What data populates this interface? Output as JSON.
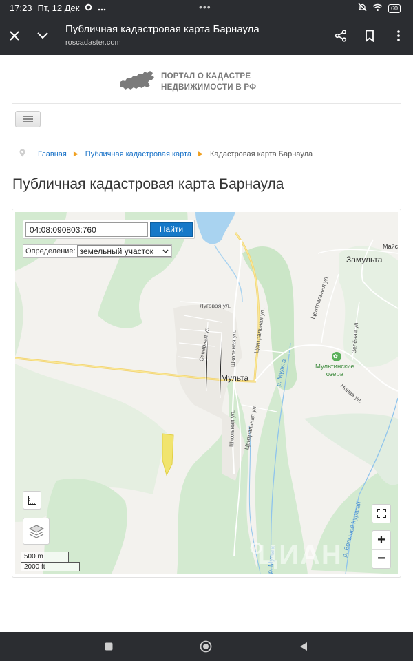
{
  "status_bar": {
    "time": "17:23",
    "date": "Пт, 12 Дек",
    "battery": "60",
    "icons": [
      "notification-dot-icon",
      "more-dots-icon",
      "mute-bell-icon",
      "wifi-icon",
      "battery-icon"
    ]
  },
  "browser": {
    "title": "Публичная кадастровая карта Барнаула",
    "url": "roscadaster.com",
    "icons": [
      "close-icon",
      "chevron-down-icon",
      "share-icon",
      "bookmark-icon",
      "kebab-menu-icon"
    ]
  },
  "site": {
    "logo_line1": "ПОРТАЛ О КАДАСТРЕ",
    "logo_line2": "НЕДВИЖИМОСТИ В РФ"
  },
  "breadcrumb": {
    "home": "Главная",
    "map": "Публичная кадастровая карта",
    "current": "Кадастровая карта Барнаула"
  },
  "page_title": "Публичная кадастровая карта Барнаула",
  "map": {
    "search_value": "04:08:090803:760",
    "find_label": "Найти",
    "definition_label": "Определение:",
    "definition_value": "земельный участок",
    "labels": {
      "village": "Мульта",
      "village2": "Замульта",
      "lakes_line1": "Мультинские",
      "lakes_line2": "озера",
      "maysk": "Майск",
      "lugovaya": "Луговая ул.",
      "severnaya": "Северная ул.",
      "shkolnaya1": "Школьная ул.",
      "shkolnaya2": "Школьная ул.",
      "centralnaya1": "Центральная ул.",
      "centralnaya2": "Центральная ул.",
      "centralnaya3": "Центральная ул.",
      "zelenaya": "Зелёная ул.",
      "novaya": "Новая ул.",
      "river_multa1": "р. Мульта",
      "river_multa2": "р. Мульта",
      "river_kuragan": "р. Большой Курагай"
    },
    "scale_metric": "500 m",
    "scale_imperial": "2000 ft",
    "zoom_in": "+",
    "zoom_out": "−",
    "watermark": "ЦИАН",
    "colors": {
      "forest": "#d3ead0",
      "background": "#f3f2ee",
      "water": "#a9d3f0",
      "road_major": "#f6e38a",
      "parcel": "#f1e46e",
      "accent": "#1678c8"
    }
  },
  "nav_bar": {
    "icons": [
      "recent-apps-icon",
      "home-icon",
      "back-icon"
    ]
  }
}
